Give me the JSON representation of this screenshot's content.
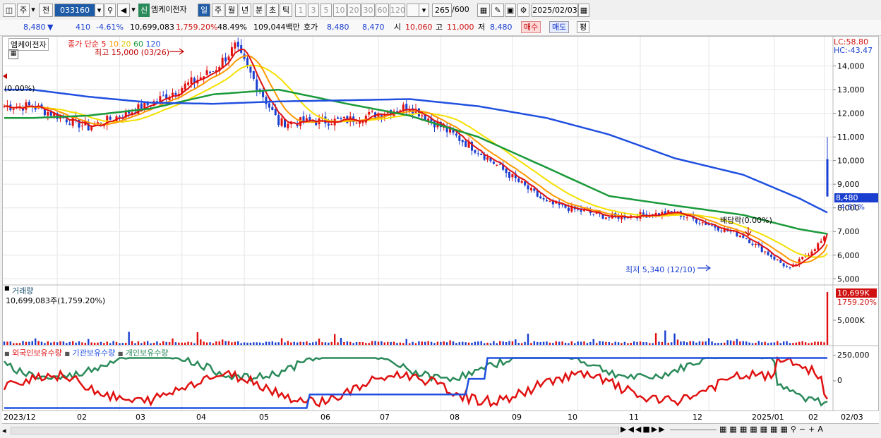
{
  "toolbar": {
    "market": "주",
    "market2": "전",
    "code": "033160",
    "new_badge": "신",
    "stock_name": "엠케이전자",
    "periods": [
      "일",
      "주",
      "월",
      "년",
      "분",
      "초",
      "틱"
    ],
    "active_period": "일",
    "intervals": [
      "1",
      "3",
      "5",
      "10",
      "20",
      "30",
      "60",
      "120"
    ],
    "count": "265",
    "count_total": "/600",
    "date": "2025/02/03"
  },
  "quote": {
    "price": "8,480",
    "arrow": "▼",
    "change": "410",
    "change_pct": "-4.61%",
    "volume": "10,699,083",
    "volume_ratio": "1,759.20%",
    "turnover": "48.49%",
    "amount": "109,044백만",
    "bid_label": "호가",
    "ask": "8,480",
    "bid": "8,470",
    "open_label": "시",
    "open": "10,060",
    "high_label": "고",
    "high": "11,000",
    "low_label": "저",
    "low": "8,480",
    "buy_label": "매수",
    "sell_label": "매도",
    "eval_label": "평"
  },
  "price_pane": {
    "name_label": "엠케이전자",
    "ma_title": "종가 단순",
    "ma_periods": [
      "5",
      "10",
      "20",
      "60",
      "120"
    ],
    "ma_colors": [
      "#e01010",
      "#ff9900",
      "#f5e000",
      "#1a9a3a",
      "#2050e0"
    ],
    "lc": "LC:58.80",
    "hc": "HC:-43.47",
    "high_note": "최고 15,000 (03/26)",
    "low_note": "최저 5,340 (12/10)",
    "ex_div_note": "배당락(0.00%)",
    "left_pct": "(0.00%)",
    "y_ticks": [
      "14,000",
      "13,000",
      "12,000",
      "11,000",
      "10,000",
      "9,000",
      "8,000",
      "7,000",
      "6,000",
      "5,000"
    ],
    "current_price_tag": "8,480",
    "current_pct_tag": "-4.61%",
    "up_color": "#e01010",
    "down_color": "#1a3fd0"
  },
  "volume_pane": {
    "title": "거래량",
    "value_text": "10,699,083주(1,759.20%)",
    "tick": "5,000K",
    "tag": "10,699K",
    "tag_pct": "1759.20%"
  },
  "holdings_pane": {
    "series": [
      "외국인보유수량",
      "기관보유수량",
      "개인보유수량"
    ],
    "series_colors": [
      "#e01010",
      "#2050e0",
      "#2a8a5a"
    ],
    "ticks": [
      "250,000",
      "0"
    ]
  },
  "x_labels": [
    "2023/12",
    "02",
    "03",
    "04",
    "05",
    "06",
    "07",
    "08",
    "09",
    "10",
    "11",
    "12",
    "2025/01",
    "02",
    "02/03"
  ],
  "chart_data": {
    "type": "line",
    "title": "엠케이전자",
    "x_range": [
      "2023/12",
      "2025/02/03"
    ],
    "ylim": [
      4800,
      15000
    ],
    "series": [
      {
        "name": "종가",
        "color": "#e01010",
        "x": [
          "2023/12",
          "2024/01",
          "2024/02",
          "2024/03",
          "2024/03/26",
          "2024/04",
          "2024/05",
          "2024/06",
          "2024/07",
          "2024/08",
          "2024/09",
          "2024/10",
          "2024/11",
          "2024/12/10",
          "2025/01",
          "2025/02/03"
        ],
        "values": [
          12300,
          11400,
          12400,
          13800,
          14800,
          11600,
          11700,
          12300,
          10400,
          8200,
          7600,
          7800,
          6800,
          5400,
          6800,
          8480
        ]
      },
      {
        "name": "120",
        "color": "#2050e0",
        "x": [
          "2023/12",
          "2024/01",
          "2024/02",
          "2024/03",
          "2024/04",
          "2024/05",
          "2024/06",
          "2024/07",
          "2024/08",
          "2024/09",
          "2024/10",
          "2024/11",
          "2024/12",
          "2025/01",
          "2025/02/03"
        ],
        "values": [
          13000,
          12700,
          12450,
          12400,
          12500,
          12550,
          12600,
          12300,
          11800,
          11100,
          10100,
          9400,
          8400,
          7800,
          7400
        ]
      },
      {
        "name": "60",
        "color": "#1a9a3a",
        "x": [
          "2023/12",
          "2024/01",
          "2024/02",
          "2024/03",
          "2024/04",
          "2024/05",
          "2024/06",
          "2024/07",
          "2024/08",
          "2024/09",
          "2024/10",
          "2024/11",
          "2024/12",
          "2025/01",
          "2025/02/03"
        ],
        "values": [
          11800,
          11900,
          12200,
          12800,
          13000,
          12400,
          11900,
          11000,
          9700,
          8500,
          8100,
          7700,
          7100,
          6900,
          6900
        ]
      }
    ],
    "volume": {
      "unit": "주",
      "last": 10699083
    },
    "holdings_series": [
      "외국인보유수량",
      "기관보유수량",
      "개인보유수량"
    ]
  }
}
